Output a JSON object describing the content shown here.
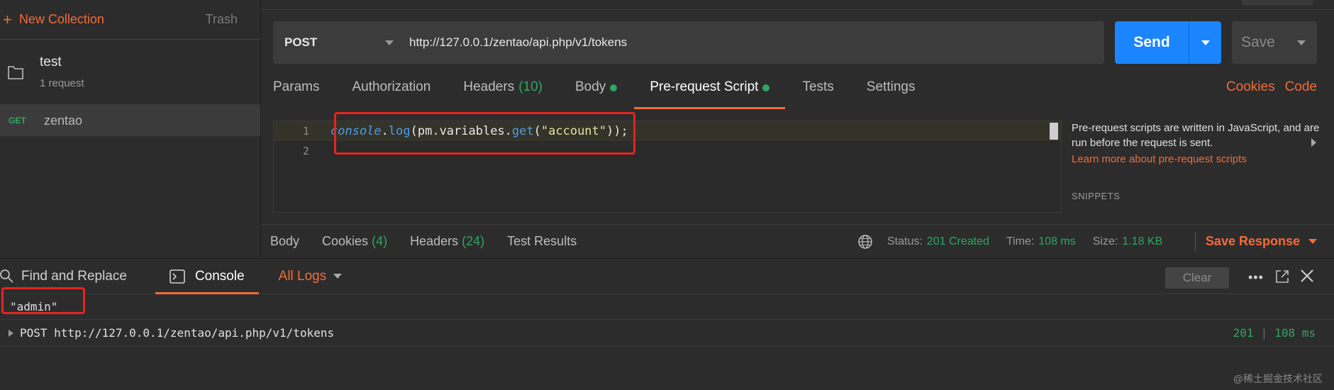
{
  "sidebar": {
    "new_collection": "New Collection",
    "trash": "Trash",
    "collection": {
      "name": "test",
      "subtitle": "1 request"
    },
    "request": {
      "method": "GET",
      "name": "zentao"
    }
  },
  "request": {
    "method": "POST",
    "url": "http://127.0.0.1/zentao/api.php/v1/tokens",
    "send_label": "Send",
    "save_label": "Save"
  },
  "tabs": {
    "params": "Params",
    "authorization": "Authorization",
    "headers": "Headers",
    "headers_count": "(10)",
    "body": "Body",
    "prerequest": "Pre-request Script",
    "tests": "Tests",
    "settings": "Settings",
    "cookies": "Cookies",
    "code": "Code"
  },
  "editor": {
    "line1_no": "1",
    "line2_no": "2",
    "tok_obj": "console",
    "tok_dot1": ".",
    "tok_fn1": "log",
    "tok_open": "(pm.variables.",
    "tok_fn2": "get",
    "tok_paren": "(",
    "tok_str": "\"account\"",
    "tok_end": "));"
  },
  "help": {
    "text": "Pre-request scripts are written in JavaScript, and are run before the request is sent.",
    "link": "Learn more about pre-request scripts",
    "snippets": "SNIPPETS"
  },
  "response": {
    "body": "Body",
    "cookies": "Cookies",
    "cookies_count": "(4)",
    "headers": "Headers",
    "headers_count": "(24)",
    "test_results": "Test Results",
    "status_label": "Status:",
    "status_value": "201 Created",
    "time_label": "Time:",
    "time_value": "108 ms",
    "size_label": "Size:",
    "size_value": "1.18 KB",
    "save_response": "Save Response"
  },
  "console": {
    "find_replace": "Find and Replace",
    "console_tab": "Console",
    "all_logs": "All Logs",
    "clear": "Clear",
    "more": "•••",
    "output": "\"admin\"",
    "log_request": "POST http://127.0.0.1/zentao/api.php/v1/tokens",
    "log_status": "201",
    "log_time": "108 ms",
    "watermark": "@稀土掘金技术社区"
  },
  "colors": {
    "accent": "#f26b3a",
    "send": "#1a85ff",
    "success": "#2fa563",
    "highlight": "#e52420"
  }
}
